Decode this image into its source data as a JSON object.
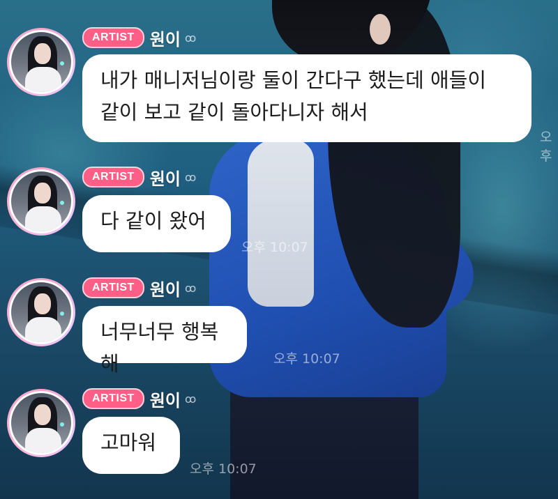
{
  "messages": [
    {
      "badge": "ARTIST",
      "name": "원이",
      "text": "내가 매니저님이랑 둘이 간다구 했는데 애들이\n같이 보고 같이 돌아다니자 해서",
      "time": "오후"
    },
    {
      "badge": "ARTIST",
      "name": "원이",
      "text": "다 같이 왔어",
      "time": "오후 10:07"
    },
    {
      "badge": "ARTIST",
      "name": "원이",
      "text": "너무너무 행복해",
      "time": "오후 10:07"
    },
    {
      "badge": "ARTIST",
      "name": "원이",
      "text": "고마워",
      "time": "오후 10:07"
    }
  ],
  "icons": {
    "glasses": "glasses-icon",
    "avatar": "profile-avatar"
  },
  "colors": {
    "badge": "#ff5f86",
    "bubble": "#ffffff",
    "text": "#1c1c1c"
  }
}
